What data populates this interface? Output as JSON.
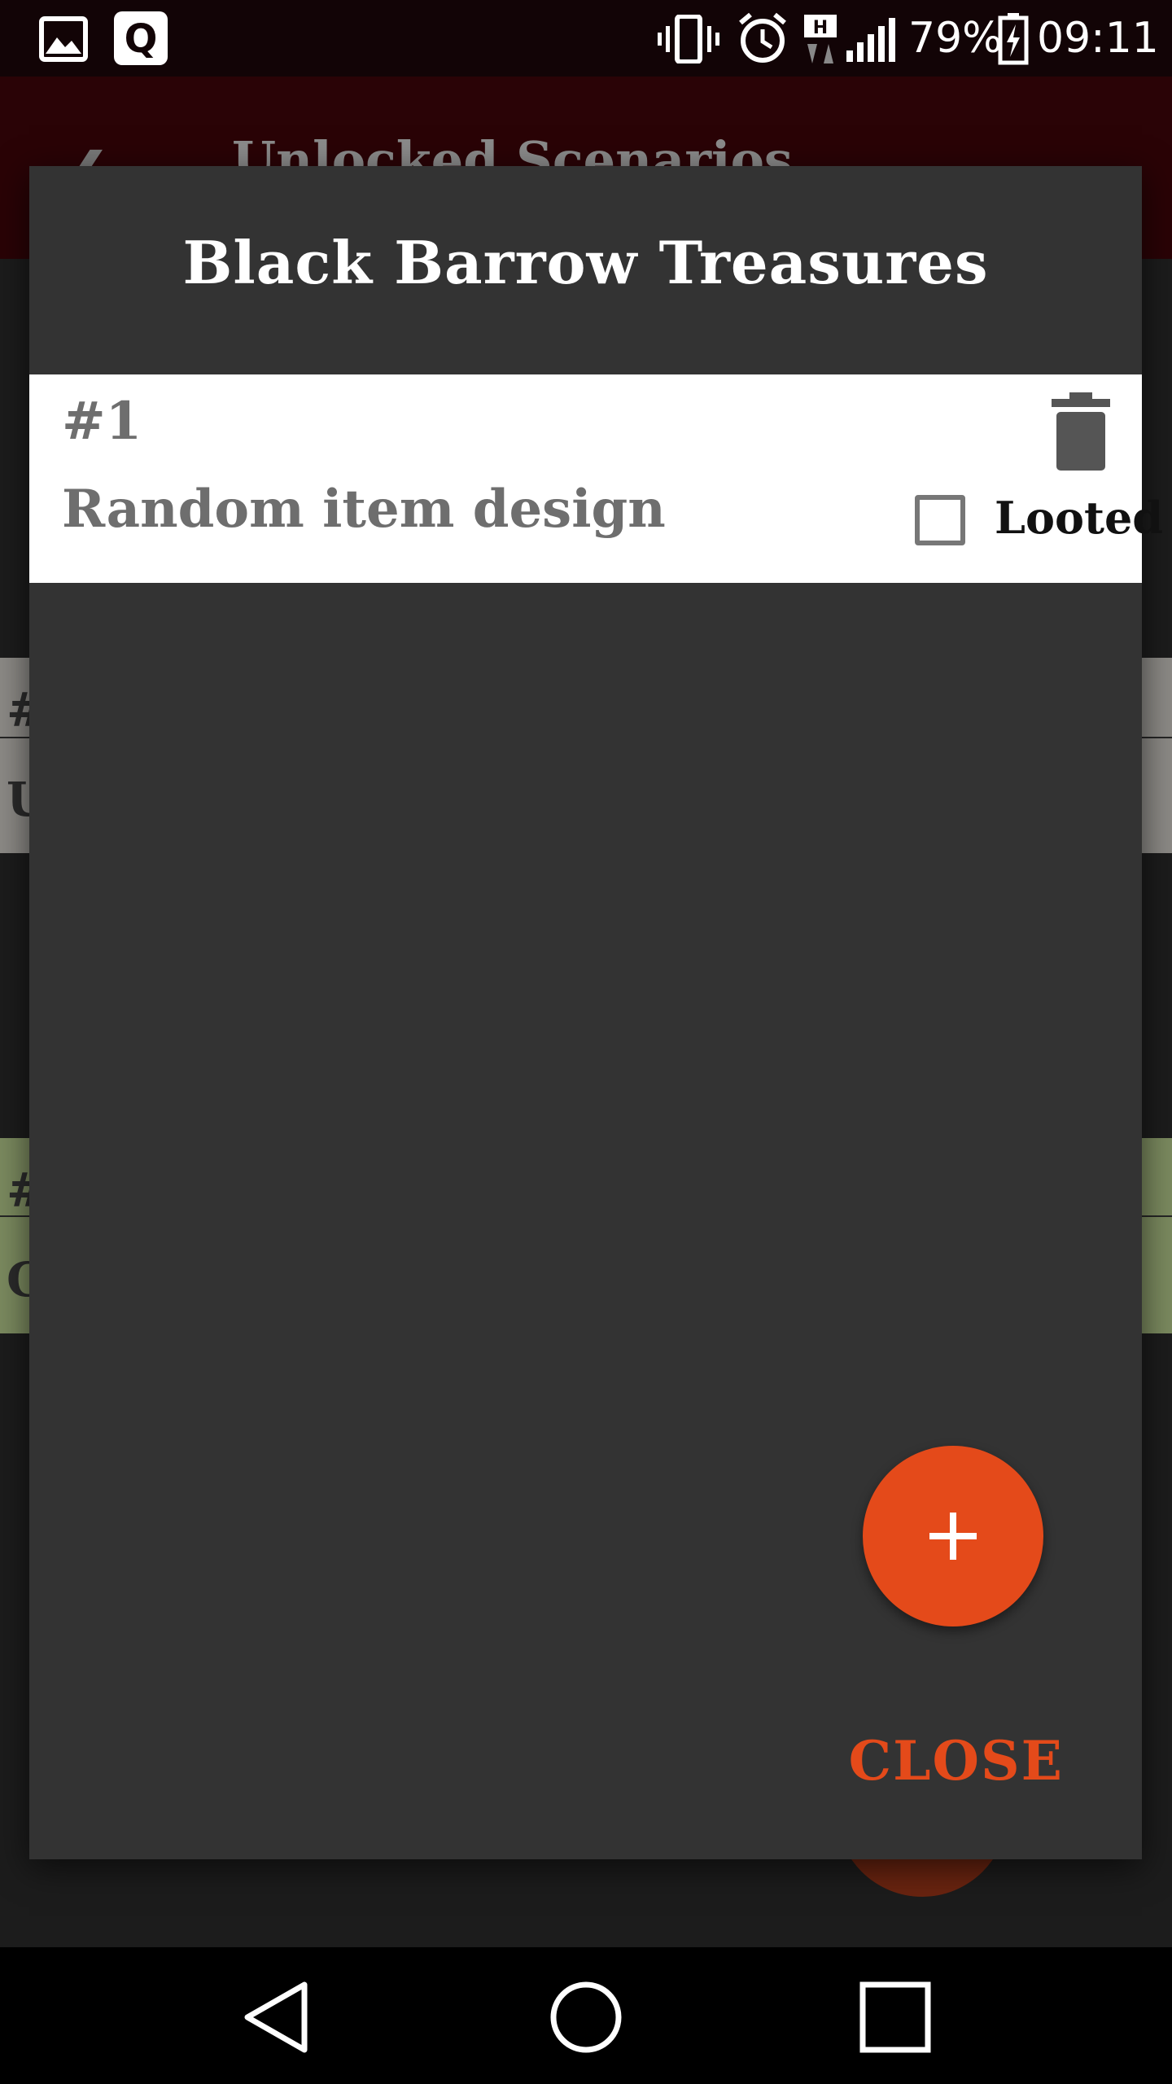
{
  "status_bar": {
    "battery_percent": "79%",
    "time": "09:11",
    "icons": [
      "gallery-icon",
      "q-app-icon",
      "vibrate-icon",
      "alarm-icon",
      "data-transfer-icon",
      "signal-icon",
      "battery-charging-icon"
    ],
    "network_label": "H"
  },
  "background_app": {
    "title": "Unlocked Scenarios",
    "card_1_number": "#",
    "card_1_initial": "U",
    "card_2_number": "#",
    "card_2_initial": "C"
  },
  "dialog": {
    "title": "Black Barrow Treasures",
    "treasure": {
      "number": "#1",
      "name": "Random item design",
      "looted_label": "Looted",
      "looted": false
    },
    "add_button_icon": "plus-icon",
    "close_label": "CLOSE"
  },
  "colors": {
    "accent": "#e44a1a",
    "dialog_bg": "#333333",
    "card_bg": "#ffffff",
    "status_bar_bg": "#120406"
  },
  "nav_bar": {
    "buttons": [
      "back-icon",
      "home-icon",
      "recents-icon"
    ]
  }
}
